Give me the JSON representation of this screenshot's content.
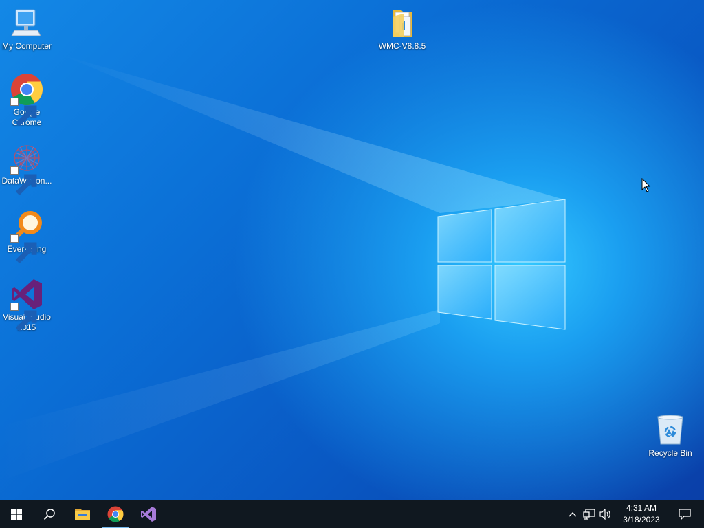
{
  "desktop": {
    "icons": [
      {
        "label": "My Computer",
        "icon": "computer-icon"
      },
      {
        "label": "Google Chrome",
        "icon": "chrome-icon"
      },
      {
        "label": "DataWagon...",
        "icon": "datawagon-icon"
      },
      {
        "label": "Everything",
        "icon": "everything-search-icon"
      },
      {
        "label": "Visual Studio 2015",
        "icon": "visual-studio-icon"
      },
      {
        "label": "WMC-V8.8.5",
        "icon": "folder-icon"
      },
      {
        "label": "Recycle Bin",
        "icon": "recycle-bin-icon"
      }
    ]
  },
  "taskbar": {
    "pinned": [
      {
        "name": "start",
        "icon": "windows-logo-icon"
      },
      {
        "name": "search",
        "icon": "search-icon"
      },
      {
        "name": "file-explorer",
        "icon": "file-explorer-icon"
      },
      {
        "name": "chrome",
        "icon": "chrome-icon",
        "active": true
      },
      {
        "name": "visual-studio",
        "icon": "visual-studio-icon"
      }
    ],
    "tray": {
      "time": "4:31 AM",
      "date": "3/18/2023"
    }
  },
  "colors": {
    "accent": "#0a78d7",
    "taskbar": "#101820",
    "active_indicator": "#76b9ed"
  }
}
